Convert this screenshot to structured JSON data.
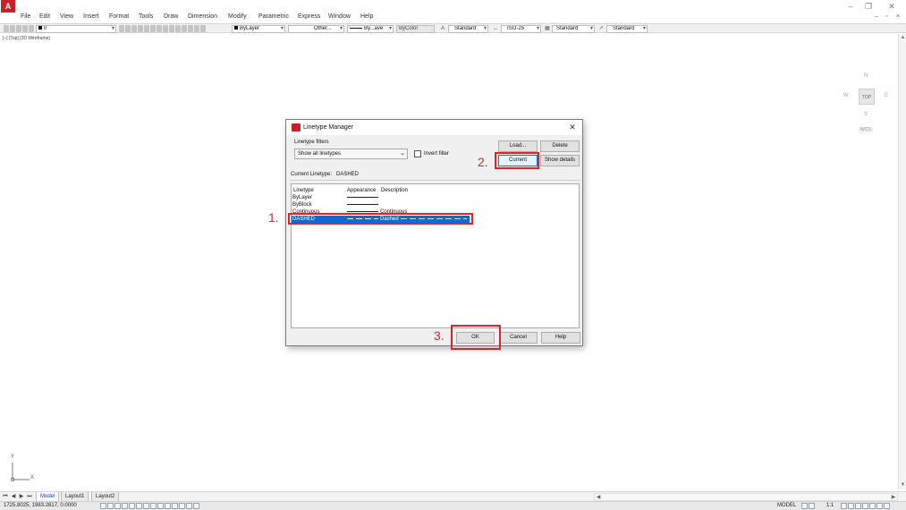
{
  "app": {
    "logo_letter": "A",
    "menu": [
      "File",
      "Edit",
      "View",
      "Insert",
      "Format",
      "Tools",
      "Draw",
      "Dimension",
      "Modify",
      "Parametric",
      "Express",
      "Window",
      "Help"
    ]
  },
  "toolbar": {
    "layer_value": "0",
    "color_value": "ByLayer",
    "linetype_value": "Other...",
    "lineweight_value": "By...ave",
    "plotstyle_value": "ByColor",
    "text_style": "Standard",
    "dim_style": "ISO-25",
    "table_style": "Standard",
    "mleader_style": "Standard"
  },
  "viewport": {
    "label": "[–] [Top] [2D Wireframe]",
    "viewcube": {
      "north": "N",
      "south": "S",
      "east": "E",
      "west": "W",
      "face": "TOP",
      "wcs": "WCS"
    },
    "ucs": {
      "x": "X",
      "y": "Y"
    }
  },
  "tabs": {
    "items": [
      "Model",
      "Layout1",
      "Layout2"
    ],
    "active": "Model"
  },
  "status": {
    "coordinates": "1725.8025, 1983.2817, 0.0000",
    "model_label": "MODEL",
    "scale_label": "1:1"
  },
  "dialog": {
    "title": "Linetype Manager",
    "filters_label": "Linetype filters",
    "filter_value": "Show all linetypes",
    "invert_filter_label": "Invert filter",
    "invert_filter_checked": false,
    "buttons": {
      "load": "Load...",
      "delete": "Delete",
      "current": "Current",
      "show_details": "Show details",
      "ok": "OK",
      "cancel": "Cancel",
      "help": "Help"
    },
    "current_linetype_label": "Current Linetype:",
    "current_linetype_value": "DASHED",
    "columns": [
      "Linetype",
      "Appearance",
      "Description"
    ],
    "rows": [
      {
        "name": "ByLayer",
        "appearance": "solid",
        "description": ""
      },
      {
        "name": "ByBlock",
        "appearance": "solid",
        "description": ""
      },
      {
        "name": "Continuous",
        "appearance": "solid",
        "description": "Continuous"
      },
      {
        "name": "DASHED",
        "appearance": "dashed",
        "description": "Dashed",
        "selected": true
      }
    ]
  },
  "annotations": [
    "1.",
    "2.",
    "3."
  ],
  "colors": {
    "accent_red": "#d9262b",
    "selection_blue": "#0a6bd6",
    "brand_red": "#c8202a"
  }
}
